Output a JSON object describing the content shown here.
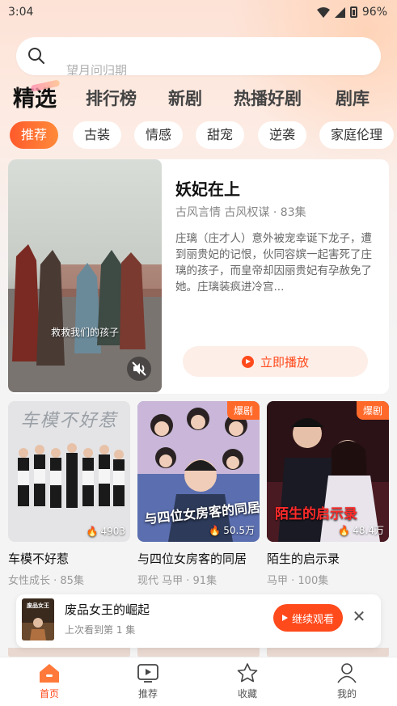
{
  "status_bar": {
    "time": "3:04",
    "battery": "96%"
  },
  "search": {
    "placeholder_prev": "",
    "placeholder": "望月问归期"
  },
  "main_tabs": [
    "精选",
    "排行榜",
    "新剧",
    "热播好剧",
    "剧库"
  ],
  "chips": [
    "推荐",
    "古装",
    "情感",
    "甜宠",
    "逆袭",
    "家庭伦理"
  ],
  "featured": {
    "title": "妖妃在上",
    "meta": "古风言情 古风权谋 · 83集",
    "description": "庄璃（庄才人）意外被宠幸诞下龙子，遭到丽贵妃的记恨，伙同容嫔一起害死了庄璃的孩子，而皇帝却因丽贵妃有孕赦免了她。庄璃装疯进冷宫...",
    "subtitle": "救救我们的孩子",
    "play_label": "立即播放"
  },
  "cards": [
    {
      "name": "车模不好惹",
      "sub": "女性成长 · 85集",
      "hot": "4903",
      "badge": "",
      "poster_text": "车模不好惹"
    },
    {
      "name": "与四位女房客的同居",
      "sub": "现代 马甲 · 91集",
      "hot": "50.5万",
      "badge": "爆剧",
      "poster_text": "与四位女房客的同居"
    },
    {
      "name": "陌生的启示录",
      "sub": "马甲 · 100集",
      "hot": "48.4万",
      "badge": "爆剧",
      "poster_text": "陌生的启示录"
    }
  ],
  "continue_watch": {
    "title": "废品女王的崛起",
    "progress": "上次看到第 1 集",
    "button": "继续观看",
    "thumb_text": "废品女王"
  },
  "bottom_nav": [
    {
      "label": "首页",
      "icon": "home-icon",
      "active": true
    },
    {
      "label": "推荐",
      "icon": "play-tv-icon",
      "active": false
    },
    {
      "label": "收藏",
      "icon": "star-icon",
      "active": false
    },
    {
      "label": "我的",
      "icon": "profile-icon",
      "active": false
    }
  ],
  "colors": {
    "accent": "#ff4a1c",
    "badge": "#ff6a2b"
  }
}
